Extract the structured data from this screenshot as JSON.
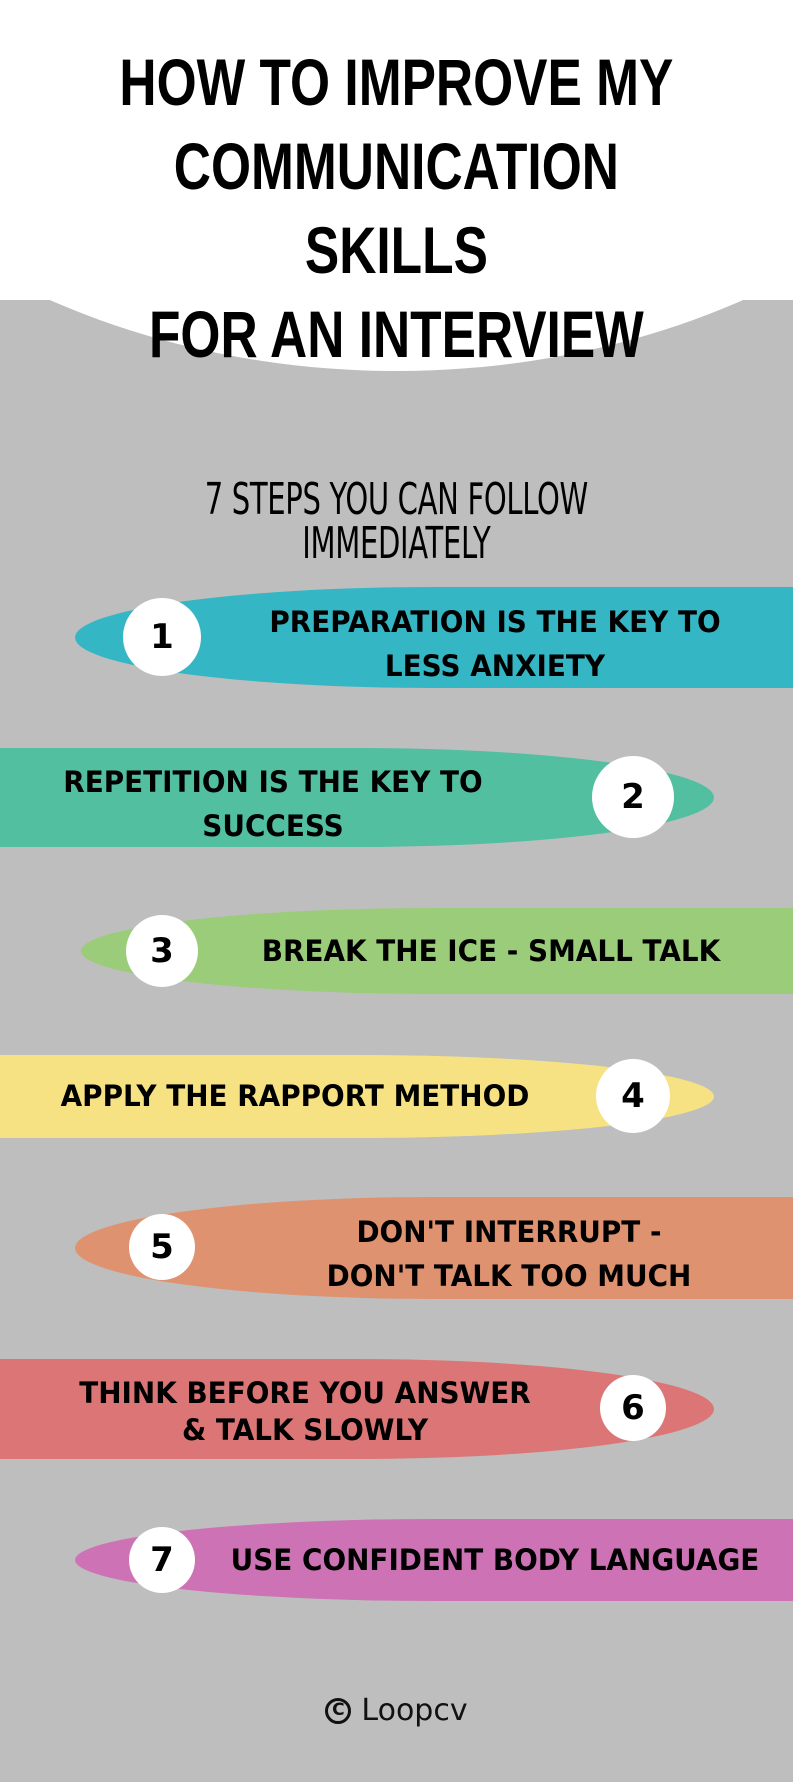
{
  "header": {
    "title_lines": [
      "HOW TO IMPROVE MY",
      "COMMUNICATION SKILLS",
      "FOR AN INTERVIEW"
    ],
    "background": "#ffffff"
  },
  "subtitle": "7 STEPS YOU CAN FOLLOW IMMEDIATELY",
  "page_background": "#bebebe",
  "steps": [
    {
      "number": "1",
      "lines": [
        "PREPARATION IS THE KEY TO",
        "LESS ANXIETY"
      ],
      "color": "#35b6c4"
    },
    {
      "number": "2",
      "lines": [
        "REPETITION IS THE KEY TO",
        "SUCCESS"
      ],
      "color": "#51bfa0"
    },
    {
      "number": "3",
      "lines": [
        "BREAK THE ICE - SMALL TALK"
      ],
      "color": "#9bcc79"
    },
    {
      "number": "4",
      "lines": [
        "APPLY THE RAPPORT METHOD"
      ],
      "color": "#f7e283"
    },
    {
      "number": "5",
      "lines": [
        "DON'T INTERRUPT -",
        "DON'T TALK TOO MUCH"
      ],
      "color": "#df926f"
    },
    {
      "number": "6",
      "lines": [
        "THINK BEFORE YOU ANSWER",
        "& TALK SLOWLY"
      ],
      "color": "#dc7676"
    },
    {
      "number": "7",
      "lines": [
        "USE CONFIDENT BODY LANGUAGE"
      ],
      "color": "#cd72b5"
    }
  ],
  "footer": {
    "icon": "copyright-icon",
    "icon_glyph": "C",
    "brand": "Loopcv"
  }
}
